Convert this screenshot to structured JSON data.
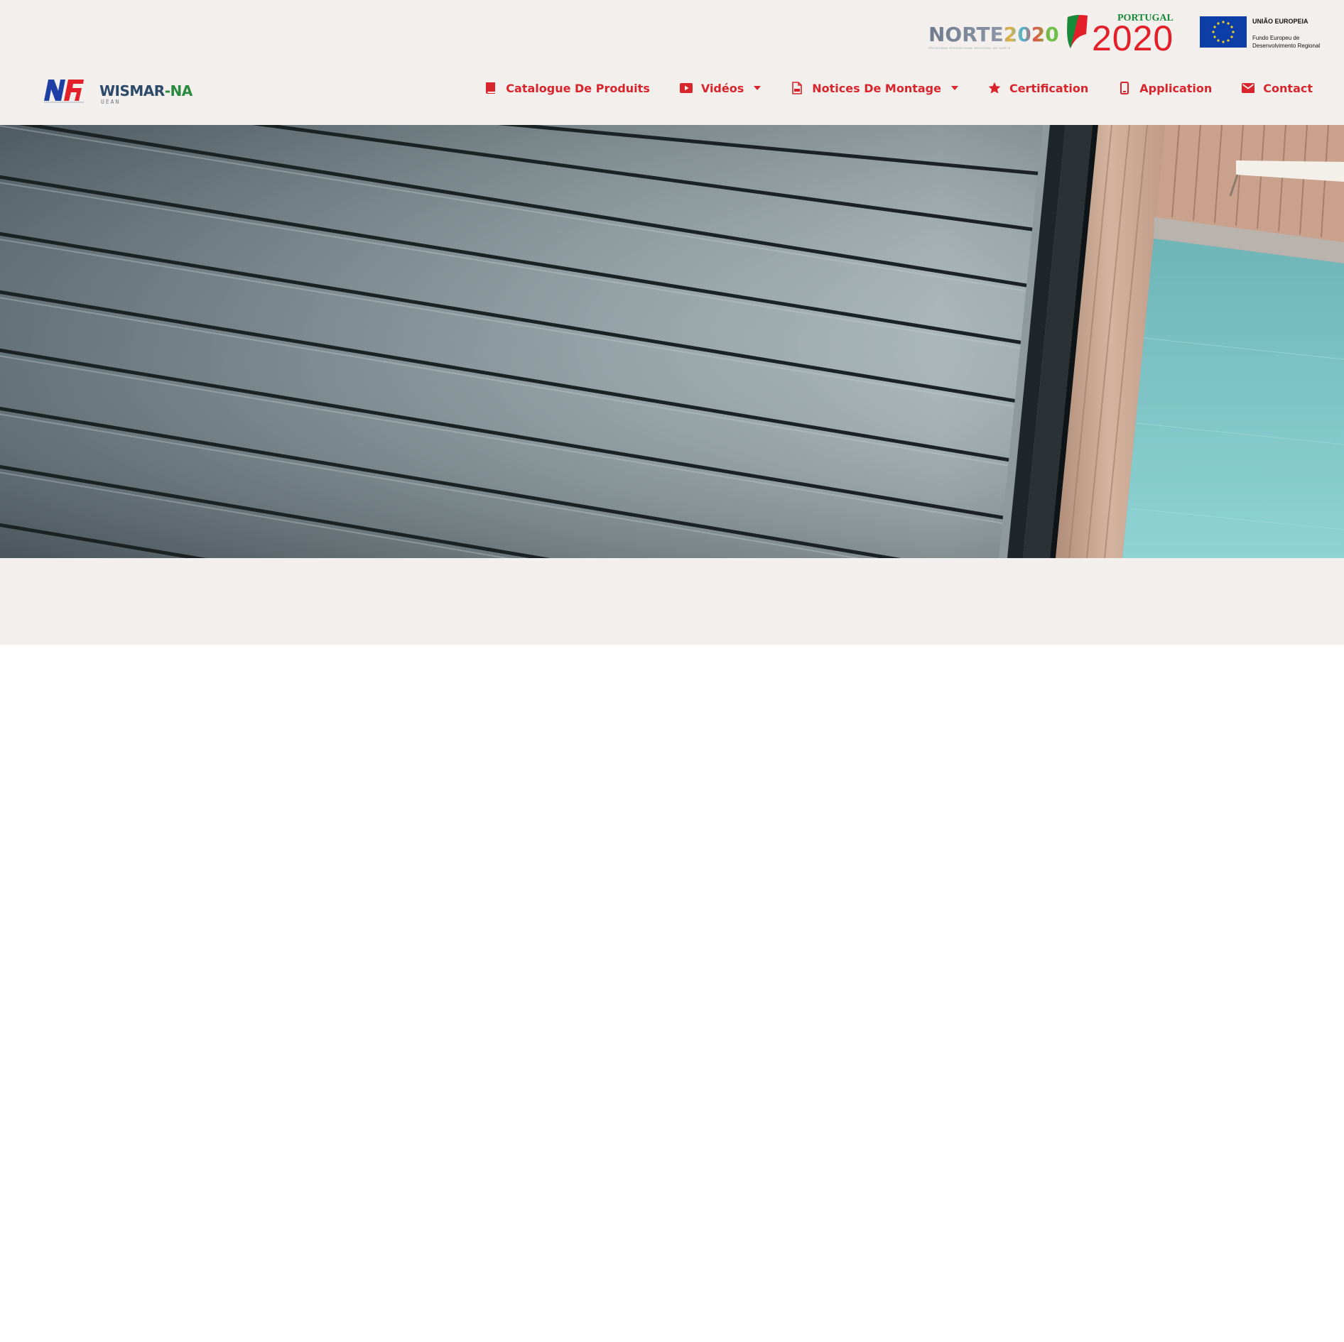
{
  "funding": {
    "norte": {
      "wordmark": "NORTE2020",
      "subtitle": "PROGRAMA OPERACIONAL REGIONAL DO NORTE"
    },
    "portugal": {
      "label": "PORTUGAL",
      "year": "2020"
    },
    "eu": {
      "title": "UNIÃO EUROPEIA",
      "subtitle": "Fundo Europeu de Desenvolvimento Regional"
    }
  },
  "brand": {
    "name_part1": "WISMAR",
    "name_part2": "-NA",
    "sub": "UEAN"
  },
  "nav": {
    "items": [
      {
        "label": "Catalogue De Produits",
        "icon": "book-icon",
        "dropdown": false
      },
      {
        "label": "Vidéos",
        "icon": "video-play-icon",
        "dropdown": true
      },
      {
        "label": "Notices De Montage",
        "icon": "pdf-file-icon",
        "dropdown": true
      },
      {
        "label": "Certification",
        "icon": "star-icon",
        "dropdown": false
      },
      {
        "label": "Application",
        "icon": "mobile-phone-icon",
        "dropdown": false
      },
      {
        "label": "Contact",
        "icon": "envelope-icon",
        "dropdown": false
      }
    ]
  },
  "hero": {
    "image": "roller-shutter-closeup-photo"
  },
  "colors": {
    "accent": "#d9242b",
    "header_bg": "#f2efec",
    "page_bg": "#ffffff"
  }
}
